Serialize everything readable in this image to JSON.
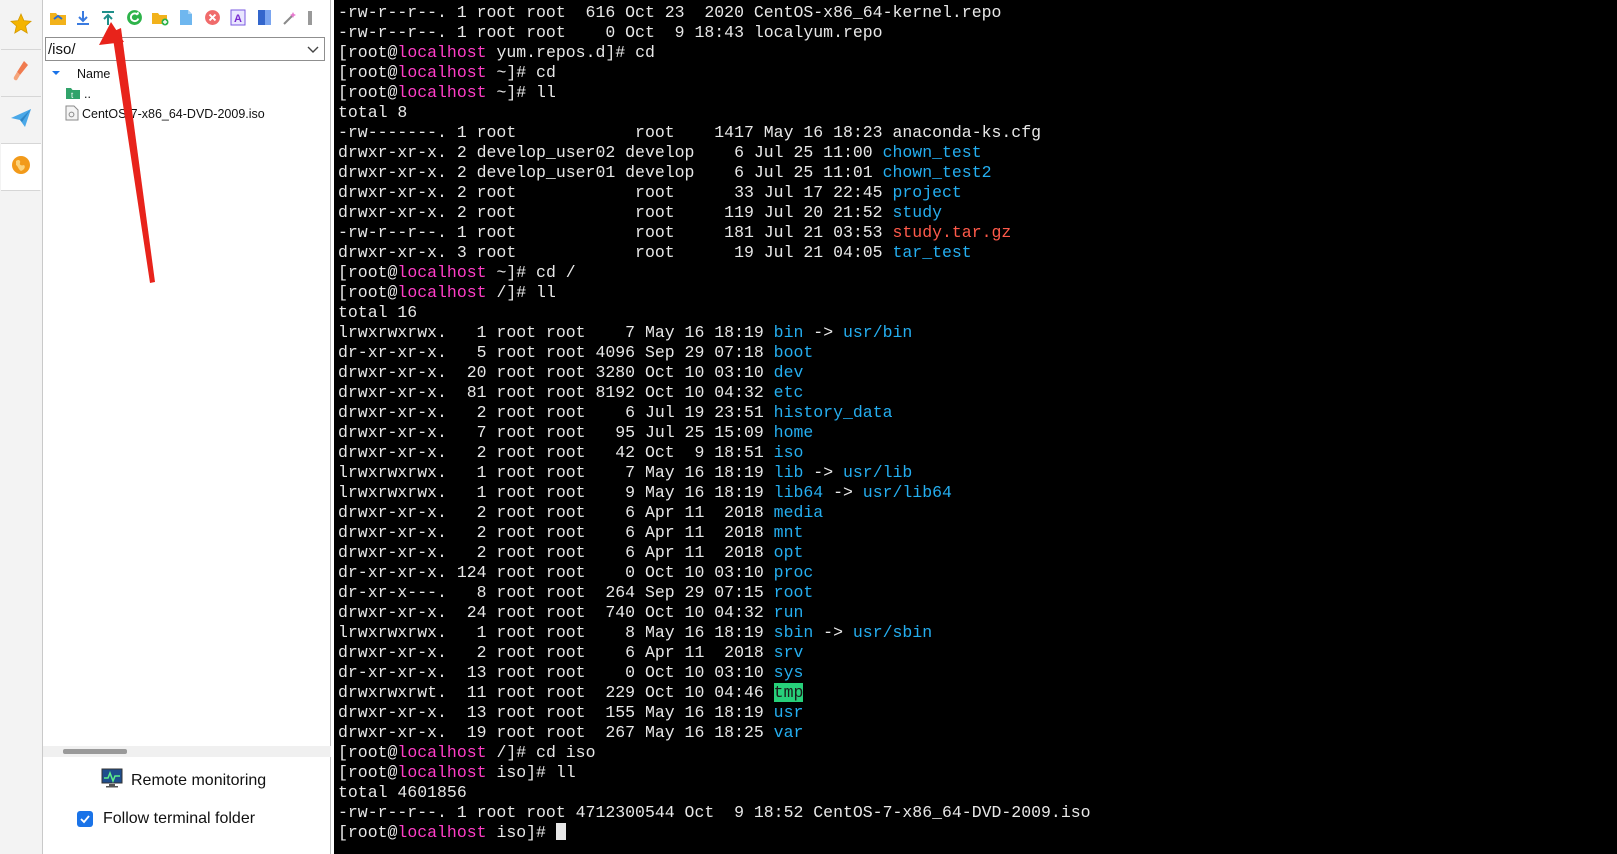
{
  "rail": {
    "items": [
      {
        "name": "favorites",
        "icon": "star-icon"
      },
      {
        "name": "tools",
        "icon": "brush-icon"
      },
      {
        "name": "send",
        "icon": "paper-plane-icon"
      },
      {
        "name": "sftp",
        "icon": "globe-icon"
      }
    ]
  },
  "sftp": {
    "path": "/iso/",
    "column_name": "Name",
    "items": [
      {
        "label": "..",
        "icon": "parent-folder-icon"
      },
      {
        "label": "CentOS-7-x86_64-DVD-2009.iso",
        "icon": "file-icon"
      }
    ],
    "remote_monitoring": "Remote monitoring",
    "follow_terminal_folder": "Follow terminal folder"
  },
  "colors": {
    "host": "#ff3ec8",
    "dir": "#24aef0",
    "archive": "#ff5a4a",
    "tmp_bg": "#27d07a",
    "annotation_arrow": "#e8231b"
  },
  "terminal": {
    "lines": [
      [
        {
          "t": "-rw-r--r--. 1 root root  616 Oct 23  2020 CentOS-x86_64-kernel.repo"
        }
      ],
      [
        {
          "t": "-rw-r--r--. 1 root root    0 Oct  9 18:43 localyum.repo"
        }
      ],
      [
        {
          "t": "[root@"
        },
        {
          "t": "localhost",
          "c": "host"
        },
        {
          "t": " yum.repos.d]# cd"
        }
      ],
      [
        {
          "t": "[root@"
        },
        {
          "t": "localhost",
          "c": "host"
        },
        {
          "t": " ~]# cd"
        }
      ],
      [
        {
          "t": "[root@"
        },
        {
          "t": "localhost",
          "c": "host"
        },
        {
          "t": " ~]# ll"
        }
      ],
      [
        {
          "t": "total 8"
        }
      ],
      [
        {
          "t": "-rw-------. 1 root            root    1417 May 16 18:23 anaconda-ks.cfg"
        }
      ],
      [
        {
          "t": "drwxr-xr-x. 2 develop_user02 develop    6 Jul 25 11:00 "
        },
        {
          "t": "chown_test",
          "c": "dir"
        }
      ],
      [
        {
          "t": "drwxr-xr-x. 2 develop_user01 develop    6 Jul 25 11:01 "
        },
        {
          "t": "chown_test2",
          "c": "dir"
        }
      ],
      [
        {
          "t": "drwxr-xr-x. 2 root            root      33 Jul 17 22:45 "
        },
        {
          "t": "project",
          "c": "dir"
        }
      ],
      [
        {
          "t": "drwxr-xr-x. 2 root            root     119 Jul 20 21:52 "
        },
        {
          "t": "study",
          "c": "dir"
        }
      ],
      [
        {
          "t": "-rw-r--r--. 1 root            root     181 Jul 21 03:53 "
        },
        {
          "t": "study.tar.gz",
          "c": "arch"
        }
      ],
      [
        {
          "t": "drwxr-xr-x. 3 root            root      19 Jul 21 04:05 "
        },
        {
          "t": "tar_test",
          "c": "dir"
        }
      ],
      [
        {
          "t": "[root@"
        },
        {
          "t": "localhost",
          "c": "host"
        },
        {
          "t": " ~]# cd /"
        }
      ],
      [
        {
          "t": "[root@"
        },
        {
          "t": "localhost",
          "c": "host"
        },
        {
          "t": " /]# ll"
        }
      ],
      [
        {
          "t": "total 16"
        }
      ],
      [
        {
          "t": "lrwxrwxrwx.   1 root root    7 May 16 18:19 "
        },
        {
          "t": "bin",
          "c": "link"
        },
        {
          "t": " -> "
        },
        {
          "t": "usr/bin",
          "c": "dir"
        }
      ],
      [
        {
          "t": "dr-xr-xr-x.   5 root root 4096 Sep 29 07:18 "
        },
        {
          "t": "boot",
          "c": "dir"
        }
      ],
      [
        {
          "t": "drwxr-xr-x.  20 root root 3280 Oct 10 03:10 "
        },
        {
          "t": "dev",
          "c": "dir"
        }
      ],
      [
        {
          "t": "drwxr-xr-x.  81 root root 8192 Oct 10 04:32 "
        },
        {
          "t": "etc",
          "c": "dir"
        }
      ],
      [
        {
          "t": "drwxr-xr-x.   2 root root    6 Jul 19 23:51 "
        },
        {
          "t": "history_data",
          "c": "dir"
        }
      ],
      [
        {
          "t": "drwxr-xr-x.   7 root root   95 Jul 25 15:09 "
        },
        {
          "t": "home",
          "c": "dir"
        }
      ],
      [
        {
          "t": "drwxr-xr-x.   2 root root   42 Oct  9 18:51 "
        },
        {
          "t": "iso",
          "c": "dir"
        }
      ],
      [
        {
          "t": "lrwxrwxrwx.   1 root root    7 May 16 18:19 "
        },
        {
          "t": "lib",
          "c": "link"
        },
        {
          "t": " -> "
        },
        {
          "t": "usr/lib",
          "c": "dir"
        }
      ],
      [
        {
          "t": "lrwxrwxrwx.   1 root root    9 May 16 18:19 "
        },
        {
          "t": "lib64",
          "c": "link"
        },
        {
          "t": " -> "
        },
        {
          "t": "usr/lib64",
          "c": "dir"
        }
      ],
      [
        {
          "t": "drwxr-xr-x.   2 root root    6 Apr 11  2018 "
        },
        {
          "t": "media",
          "c": "dir"
        }
      ],
      [
        {
          "t": "drwxr-xr-x.   2 root root    6 Apr 11  2018 "
        },
        {
          "t": "mnt",
          "c": "dir"
        }
      ],
      [
        {
          "t": "drwxr-xr-x.   2 root root    6 Apr 11  2018 "
        },
        {
          "t": "opt",
          "c": "dir"
        }
      ],
      [
        {
          "t": "dr-xr-xr-x. 124 root root    0 Oct 10 03:10 "
        },
        {
          "t": "proc",
          "c": "dir"
        }
      ],
      [
        {
          "t": "dr-xr-x---.   8 root root  264 Sep 29 07:15 "
        },
        {
          "t": "root",
          "c": "dir"
        }
      ],
      [
        {
          "t": "drwxr-xr-x.  24 root root  740 Oct 10 04:32 "
        },
        {
          "t": "run",
          "c": "dir"
        }
      ],
      [
        {
          "t": "lrwxrwxrwx.   1 root root    8 May 16 18:19 "
        },
        {
          "t": "sbin",
          "c": "link"
        },
        {
          "t": " -> "
        },
        {
          "t": "usr/sbin",
          "c": "dir"
        }
      ],
      [
        {
          "t": "drwxr-xr-x.   2 root root    6 Apr 11  2018 "
        },
        {
          "t": "srv",
          "c": "dir"
        }
      ],
      [
        {
          "t": "dr-xr-xr-x.  13 root root    0 Oct 10 03:10 "
        },
        {
          "t": "sys",
          "c": "dir"
        }
      ],
      [
        {
          "t": "drwxrwxrwt.  11 root root  229 Oct 10 04:46 "
        },
        {
          "t": "tmp",
          "c": "tmp"
        }
      ],
      [
        {
          "t": "drwxr-xr-x.  13 root root  155 May 16 18:19 "
        },
        {
          "t": "usr",
          "c": "dir"
        }
      ],
      [
        {
          "t": "drwxr-xr-x.  19 root root  267 May 16 18:25 "
        },
        {
          "t": "var",
          "c": "dir"
        }
      ],
      [
        {
          "t": "[root@"
        },
        {
          "t": "localhost",
          "c": "host"
        },
        {
          "t": " /]# cd iso"
        }
      ],
      [
        {
          "t": "[root@"
        },
        {
          "t": "localhost",
          "c": "host"
        },
        {
          "t": " iso]# ll"
        }
      ],
      [
        {
          "t": "total 4601856"
        }
      ],
      [
        {
          "t": "-rw-r--r--. 1 root root 4712300544 Oct  9 18:52 CentOS-7-x86_64-DVD-2009.iso"
        }
      ],
      [
        {
          "t": "[root@"
        },
        {
          "t": "localhost",
          "c": "host"
        },
        {
          "t": " iso]# "
        }
      ]
    ]
  }
}
